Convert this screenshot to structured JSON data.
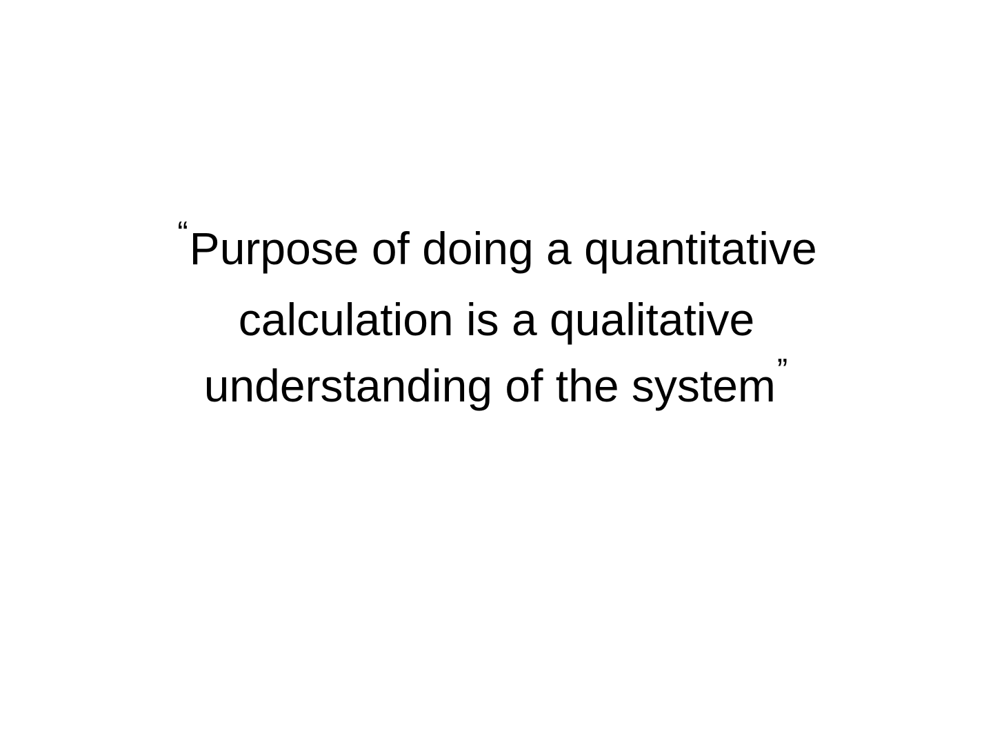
{
  "slide": {
    "open_quote": "“",
    "close_quote": "”",
    "lines": [
      "Purpose of doing a quantitative",
      "calculation is a qualitative",
      "understanding of the system"
    ]
  }
}
